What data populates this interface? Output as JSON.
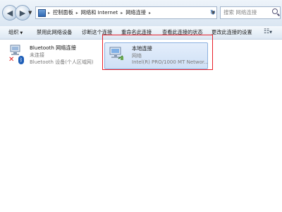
{
  "address": {
    "breadcrumbs": [
      "控制面板",
      "网络和 Internet",
      "网络连接"
    ],
    "placeholder": ""
  },
  "search": {
    "placeholder": "搜索 网络连接"
  },
  "toolbar": {
    "organize": "组织",
    "disable": "禁用此网络设备",
    "diagnose": "诊断这个连接",
    "rename": "重命名此连接",
    "view_status": "查看此连接的状态",
    "change_settings": "更改此连接的设置"
  },
  "connections": [
    {
      "name": "Bluetooth 网络连接",
      "status": "未连接",
      "device": "Bluetooth 设备(个人区域网)",
      "icon": "network-adapter-icon"
    },
    {
      "name": "本地连接",
      "status": "网络",
      "device": "Intel(R) PRO/1000 MT Networ...",
      "icon": "network-adapter-icon"
    }
  ],
  "colors": {
    "highlight": "#e8202a",
    "selection": "#cfe0f6"
  }
}
